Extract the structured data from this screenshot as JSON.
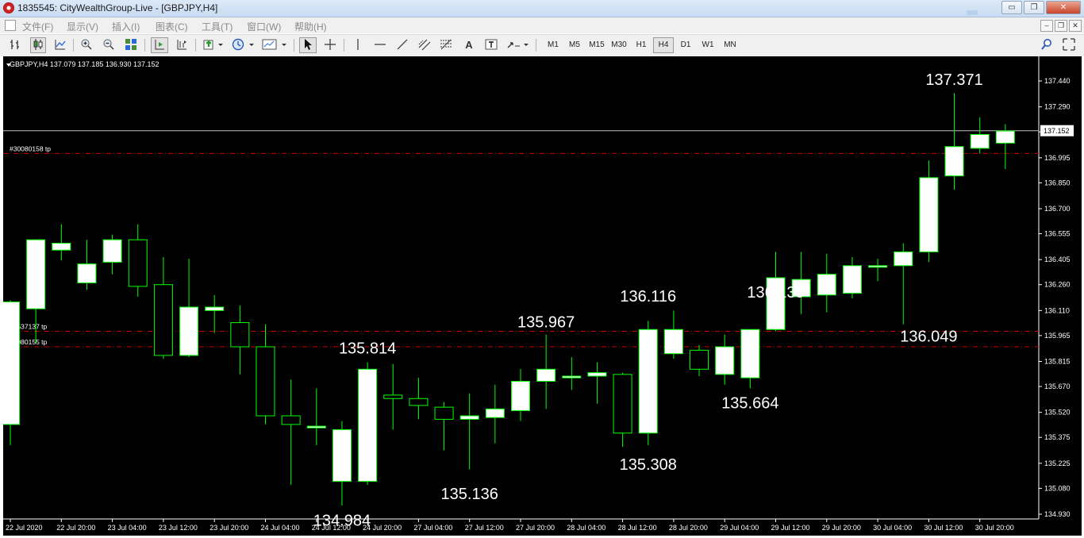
{
  "window": {
    "title": "1835545: CityWealthGroup-Live - [GBPJPY,H4]",
    "buttons": {
      "minimize": "▭",
      "restore": "❐",
      "close": "✕"
    }
  },
  "menu": {
    "items": [
      "文件(F)",
      "显示(V)",
      "插入(I)",
      "图表(C)",
      "工具(T)",
      "窗口(W)",
      "帮助(H)"
    ],
    "mdi_buttons": [
      "–",
      "❐",
      "✕"
    ]
  },
  "toolbar": {
    "timeframes": [
      "M1",
      "M5",
      "M15",
      "M30",
      "H1",
      "H4",
      "D1",
      "W1",
      "MN"
    ],
    "active_timeframe": "H4",
    "icons": [
      "bar-chart-icon",
      "candlestick-icon",
      "line-chart-icon",
      "zoom-in-icon",
      "zoom-out-icon",
      "tile-windows-icon",
      "autoscroll-icon",
      "chart-shift-icon",
      "indicators-icon",
      "periods-icon",
      "templates-icon",
      "cursor-icon",
      "crosshair-icon",
      "vertical-line-icon",
      "horizontal-line-icon",
      "trendline-icon",
      "channel-icon",
      "fibonacci-icon",
      "text-icon",
      "text-label-icon",
      "arrows-icon",
      "search-icon",
      "expand-icon"
    ]
  },
  "chart": {
    "symbol_info": "GBPJPY,H4  137.079 137.185 136.930 137.152",
    "current_price": "137.152",
    "colors": {
      "background": "#000000",
      "bull_body": "#ffffff",
      "candle_outline": "#00ff00",
      "order_line": "#cc0000",
      "bid_line": "#c0c0c0",
      "axis_text": "#ffffff"
    }
  },
  "chart_data": {
    "type": "candlestick",
    "symbol": "GBPJPY",
    "timeframe": "H4",
    "ylim": [
      134.93,
      137.5
    ],
    "y_ticks": [
      "137.440",
      "137.290",
      "137.145",
      "136.995",
      "136.850",
      "136.700",
      "136.555",
      "136.405",
      "136.260",
      "136.110",
      "135.965",
      "135.815",
      "135.670",
      "135.520",
      "135.375",
      "135.225",
      "135.080",
      "134.930"
    ],
    "x_tick_labels": [
      "22 Jul 2020",
      "22 Jul 20:00",
      "23 Jul 04:00",
      "23 Jul 12:00",
      "23 Jul 20:00",
      "24 Jul 04:00",
      "24 Jul 12:00",
      "24 Jul 20:00",
      "27 Jul 04:00",
      "27 Jul 12:00",
      "27 Jul 20:00",
      "28 Jul 04:00",
      "28 Jul 12:00",
      "28 Jul 20:00",
      "29 Jul 04:00",
      "29 Jul 12:00",
      "29 Jul 20:00",
      "30 Jul 04:00",
      "30 Jul 12:00",
      "30 Jul 20:00"
    ],
    "candles": [
      {
        "o": 135.45,
        "h": 136.17,
        "l": 135.33,
        "c": 136.16
      },
      {
        "o": 136.12,
        "h": 136.52,
        "l": 135.92,
        "c": 136.52
      },
      {
        "o": 136.46,
        "h": 136.61,
        "l": 136.4,
        "c": 136.5
      },
      {
        "o": 136.27,
        "h": 136.52,
        "l": 136.23,
        "c": 136.38
      },
      {
        "o": 136.39,
        "h": 136.55,
        "l": 136.32,
        "c": 136.52
      },
      {
        "o": 136.52,
        "h": 136.61,
        "l": 136.19,
        "c": 136.25
      },
      {
        "o": 136.26,
        "h": 136.42,
        "l": 135.83,
        "c": 135.85
      },
      {
        "o": 135.85,
        "h": 136.41,
        "l": 135.84,
        "c": 136.13
      },
      {
        "o": 136.11,
        "h": 136.2,
        "l": 135.98,
        "c": 136.13
      },
      {
        "o": 136.04,
        "h": 136.14,
        "l": 135.74,
        "c": 135.9
      },
      {
        "o": 135.9,
        "h": 136.03,
        "l": 135.45,
        "c": 135.5
      },
      {
        "o": 135.5,
        "h": 135.71,
        "l": 135.1,
        "c": 135.45
      },
      {
        "o": 135.43,
        "h": 135.66,
        "l": 135.33,
        "c": 135.44
      },
      {
        "o": 135.12,
        "h": 135.47,
        "l": 134.98,
        "c": 135.42
      },
      {
        "o": 135.12,
        "h": 135.81,
        "l": 135.1,
        "c": 135.77
      },
      {
        "o": 135.62,
        "h": 135.8,
        "l": 135.42,
        "c": 135.6
      },
      {
        "o": 135.6,
        "h": 135.72,
        "l": 135.48,
        "c": 135.56
      },
      {
        "o": 135.55,
        "h": 135.58,
        "l": 135.3,
        "c": 135.48
      },
      {
        "o": 135.48,
        "h": 135.63,
        "l": 135.19,
        "c": 135.5
      },
      {
        "o": 135.49,
        "h": 135.68,
        "l": 135.34,
        "c": 135.54
      },
      {
        "o": 135.53,
        "h": 135.77,
        "l": 135.47,
        "c": 135.7
      },
      {
        "o": 135.7,
        "h": 135.97,
        "l": 135.54,
        "c": 135.77
      },
      {
        "o": 135.72,
        "h": 135.84,
        "l": 135.65,
        "c": 135.73
      },
      {
        "o": 135.73,
        "h": 135.81,
        "l": 135.57,
        "c": 135.75
      },
      {
        "o": 135.74,
        "h": 135.75,
        "l": 135.32,
        "c": 135.4
      },
      {
        "o": 135.4,
        "h": 136.05,
        "l": 135.33,
        "c": 136.0
      },
      {
        "o": 135.86,
        "h": 136.11,
        "l": 135.83,
        "c": 136.0
      },
      {
        "o": 135.88,
        "h": 135.91,
        "l": 135.73,
        "c": 135.77
      },
      {
        "o": 135.74,
        "h": 135.97,
        "l": 135.68,
        "c": 135.9
      },
      {
        "o": 135.72,
        "h": 136.0,
        "l": 135.66,
        "c": 136.0
      },
      {
        "o": 136.0,
        "h": 136.45,
        "l": 135.99,
        "c": 136.3
      },
      {
        "o": 136.19,
        "h": 136.45,
        "l": 136.09,
        "c": 136.29
      },
      {
        "o": 136.2,
        "h": 136.44,
        "l": 136.1,
        "c": 136.32
      },
      {
        "o": 136.21,
        "h": 136.42,
        "l": 136.18,
        "c": 136.37
      },
      {
        "o": 136.37,
        "h": 136.41,
        "l": 136.28,
        "c": 136.37
      },
      {
        "o": 136.37,
        "h": 136.5,
        "l": 136.03,
        "c": 136.45
      },
      {
        "o": 136.45,
        "h": 136.98,
        "l": 136.39,
        "c": 136.88
      },
      {
        "o": 136.89,
        "h": 137.37,
        "l": 136.81,
        "c": 137.06
      },
      {
        "o": 137.05,
        "h": 137.23,
        "l": 137.02,
        "c": 137.13
      },
      {
        "o": 137.08,
        "h": 137.19,
        "l": 136.93,
        "c": 137.15
      }
    ],
    "annotations": [
      {
        "text": "137.371",
        "price": 137.371,
        "candle": 37,
        "pos": "above"
      },
      {
        "text": "136.139",
        "price": 136.139,
        "candle": 30,
        "pos": "above"
      },
      {
        "text": "136.116",
        "price": 136.116,
        "candle": 25,
        "pos": "above"
      },
      {
        "text": "135.967",
        "price": 135.967,
        "candle": 21,
        "pos": "above"
      },
      {
        "text": "135.814",
        "price": 135.814,
        "candle": 14,
        "pos": "above"
      },
      {
        "text": "136.049",
        "price": 136.049,
        "candle": 36,
        "pos": "below"
      },
      {
        "text": "135.664",
        "price": 135.664,
        "candle": 29,
        "pos": "below"
      },
      {
        "text": "135.308",
        "price": 135.308,
        "candle": 25,
        "pos": "below"
      },
      {
        "text": "135.136",
        "price": 135.136,
        "candle": 18,
        "pos": "below"
      },
      {
        "text": "134.984",
        "price": 134.984,
        "candle": 13,
        "pos": "below"
      }
    ],
    "order_lines": [
      {
        "label": "#30080158 tp",
        "price": 137.02
      },
      {
        "label": "29537137 tp",
        "price": 135.99
      },
      {
        "label": "30080155 tp",
        "price": 135.9
      }
    ],
    "bid_price": 137.152,
    "bid_label": "137.152"
  }
}
